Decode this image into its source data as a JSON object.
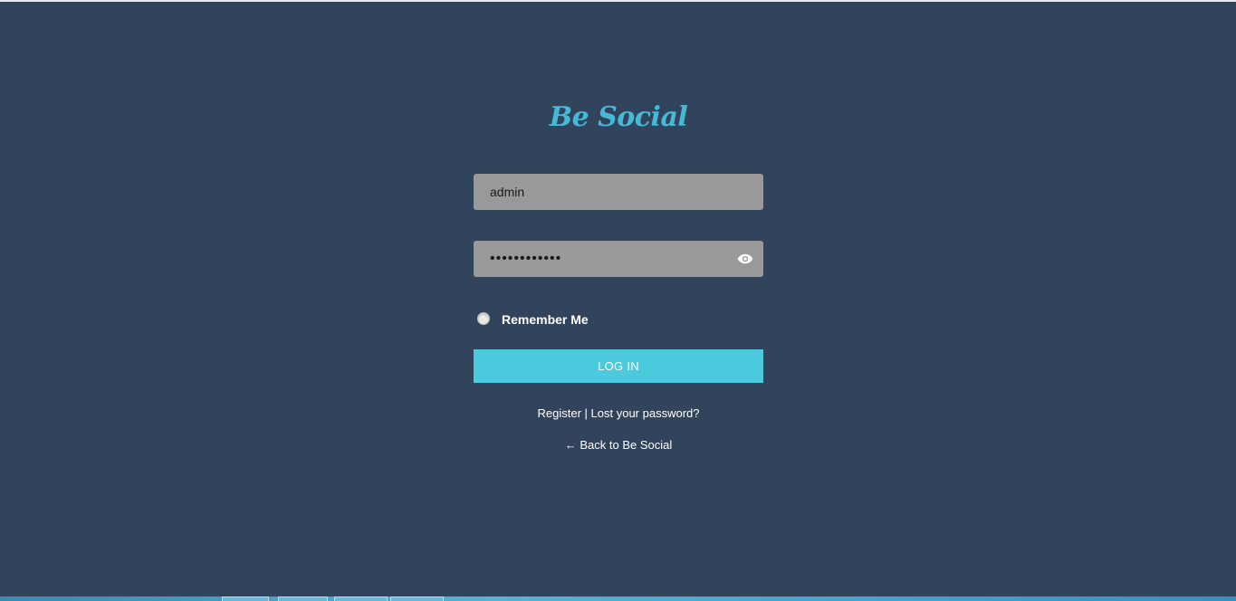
{
  "logo": {
    "text": "Be Social"
  },
  "login_form": {
    "username_value": "admin",
    "password_value": "••••••••••••",
    "remember_label": "Remember Me",
    "submit_label": "LOG IN"
  },
  "links": {
    "register": "Register",
    "separator": " | ",
    "lost_password": "Lost your password?",
    "back": "← Back to Be Social"
  },
  "colors": {
    "background": "#32445c",
    "accent": "#4ccadd",
    "logo": "#45b9d6",
    "input_bg": "#999999"
  },
  "icons": {
    "password_toggle": "eye-icon"
  }
}
